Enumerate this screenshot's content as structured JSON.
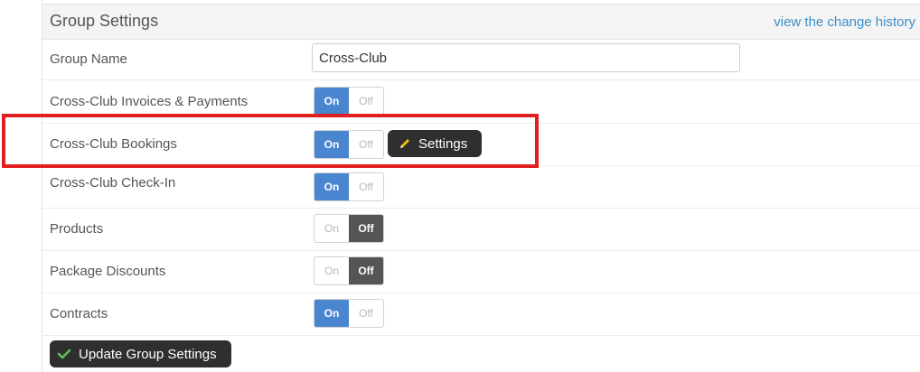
{
  "header": {
    "title": "Group Settings",
    "history_link": "view the change history"
  },
  "group_name": {
    "label": "Group Name",
    "value": "Cross-Club"
  },
  "toggle_text": {
    "on": "On",
    "off": "Off"
  },
  "rows": [
    {
      "label": "Cross-Club Invoices & Payments",
      "state": "on"
    },
    {
      "label": "Cross-Club Bookings",
      "state": "on"
    },
    {
      "label": "Cross-Club Check-In",
      "state": "on"
    },
    {
      "label": "Products",
      "state": "off"
    },
    {
      "label": "Package Discounts",
      "state": "off"
    },
    {
      "label": "Contracts",
      "state": "on"
    }
  ],
  "bookings_settings_button": {
    "label": "Settings",
    "icon": "pencil-icon"
  },
  "update_button": {
    "label": "Update Group Settings",
    "icon": "checkmark-icon"
  },
  "colors": {
    "on_active": "#4a86cf",
    "off_active": "#555555",
    "link": "#3a8fc8",
    "highlight_border": "#e02020",
    "dark_button": "#2f2f2f"
  }
}
